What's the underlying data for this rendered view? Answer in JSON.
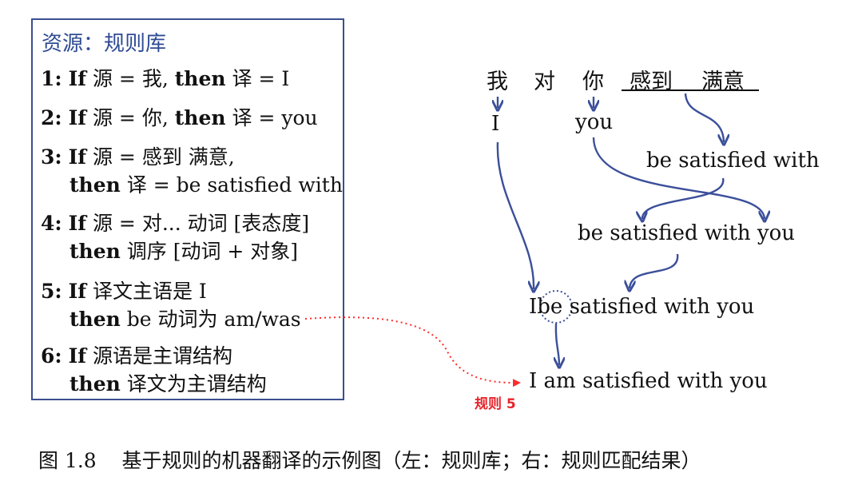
{
  "rules_panel": {
    "title": "资源：规则库",
    "rules": [
      {
        "num": "1:",
        "kw_if": "If",
        "cond": "源 = 我,",
        "kw_then": "then",
        "action": "译 = I"
      },
      {
        "num": "2:",
        "kw_if": "If",
        "cond": "源 = 你,",
        "kw_then": "then",
        "action": "译 = you"
      },
      {
        "num": "3:",
        "kw_if": "If",
        "cond": "源 = 感到 满意,",
        "kw_then": "then",
        "action": "译 = be satisfied with"
      },
      {
        "num": "4:",
        "kw_if": "If",
        "cond": "源 = 对... 动词 [表态度]",
        "kw_then": "then",
        "action": "调序 [动词 + 对象]"
      },
      {
        "num": "5:",
        "kw_if": "If",
        "cond": "译文主语是 I",
        "kw_then": "then",
        "action": "be 动词为 am/was"
      },
      {
        "num": "6:",
        "kw_if": "If",
        "cond": "源语是主谓结构",
        "kw_then": "then",
        "action": "译文为主谓结构"
      }
    ]
  },
  "diagram": {
    "source_words": [
      "我",
      "对",
      "你",
      "感到",
      "满意"
    ],
    "i_word": "I",
    "you_word": "you",
    "phrase_be_satisfied_with": "be satisfied with",
    "phrase_be_satisfied_with_you": "be satisfied with you",
    "i_before_be": "I",
    "i_be_highlight": "be",
    "i_be_rest": "satisfied with you",
    "final_sentence": "I am satisfied with you",
    "rule5_label": "规则 5",
    "colors": {
      "arrow": "#3b4f9a",
      "rule_link": "#ff2a2a",
      "box_border": "#3b4f8f",
      "title": "#2f4b94"
    }
  },
  "caption": "图 1.8    基于规则的机器翻译的示例图（左：规则库；右：规则匹配结果）"
}
